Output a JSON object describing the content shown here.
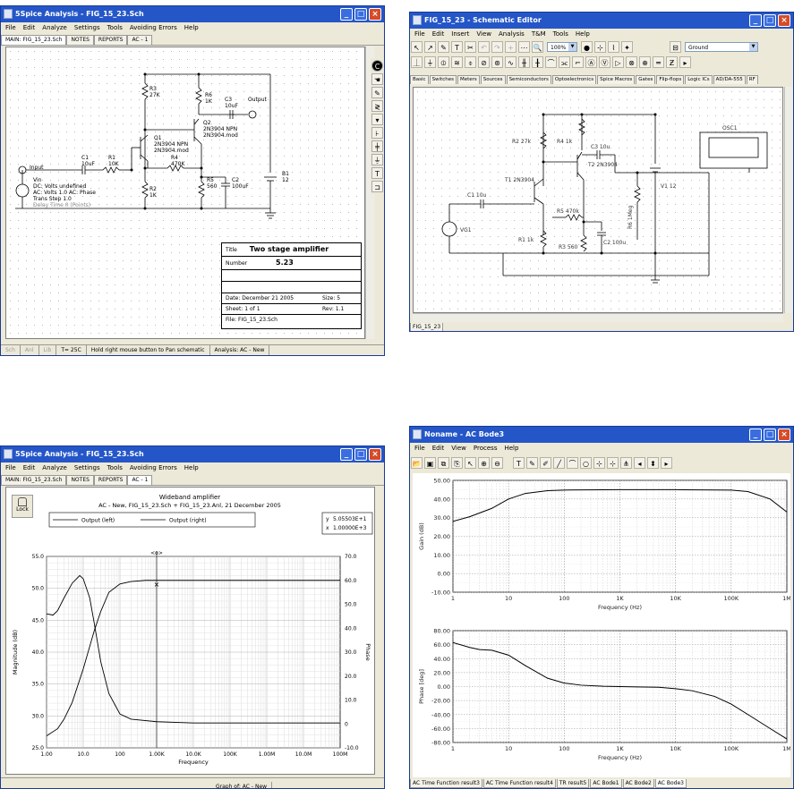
{
  "win1": {
    "title": "5Spice Analysis - FIG_15_23.Sch",
    "menu": [
      "File",
      "Edit",
      "Analyze",
      "Settings",
      "Tools",
      "Avoiding Errors",
      "Help"
    ],
    "tabs": [
      "MAIN: FIG_15_23.Sch",
      "NOTES",
      "REPORTS",
      "AC - 1"
    ],
    "components": {
      "r3": "R3",
      "r3v": "27K",
      "r6": "R6",
      "r6v": "1K",
      "c3": "C3",
      "c3v": "10uF",
      "output": "Output",
      "q2": "Q2",
      "q2m": "2N3904 NPN",
      "q2f": "2N3904.mod",
      "q1": "Q1",
      "q1m": "2N3904 NPN",
      "q1f": "2N3904.mod",
      "c1": "C1",
      "c1v": "10uF",
      "r1": "R1",
      "r1v": "10K",
      "r4": "R4",
      "r4v": "470K",
      "r5": "R5",
      "r5v": "560",
      "c2": "C2",
      "c2v": "100uF",
      "b1": "B1",
      "b1v": "12",
      "r2": "R2",
      "r2v": "1K",
      "input": "Input",
      "vin": "Vin",
      "vin_dc": "DC: Volts undefined",
      "vin_ac": "AC: Volts 1.0 AC: Phase",
      "vin_trans": "Trans Step 1.0",
      "vin_extra": "Delay Time 0 (Points)"
    },
    "titleblock": {
      "title_label": "Title",
      "title_value": "Two stage amplifier",
      "number_label": "Number",
      "number_value": "5.23",
      "date": "Date: December 21 2005",
      "size": "Size: 5",
      "sheet": "Sheet: 1 of 1",
      "rev": "Rev: 1.1",
      "file": "File: FIG_15_23.Sch"
    },
    "status": [
      "Sch",
      "Anl",
      "Lib",
      "T= 25C",
      "Hold right mouse button to Pan schematic",
      "Analysis: AC - New"
    ]
  },
  "win2": {
    "title": "FIG_15_23 - Schematic Editor",
    "menu": [
      "File",
      "Edit",
      "Insert",
      "View",
      "Analysis",
      "T&M",
      "Tools",
      "Help"
    ],
    "zoom": "100%",
    "ground": "Ground",
    "comp_tabs": [
      "Basic",
      "Switches",
      "Meters",
      "Sources",
      "Semiconductors",
      "Optoelectronics",
      "Spice Macros",
      "Gates",
      "Flip-flops",
      "Logic ICs",
      "AD/DA-555",
      "RF"
    ],
    "components": {
      "r2": "R2 27k",
      "r4": "R4 1k",
      "c3": "C3 10u",
      "t2": "T2 2N3904",
      "t1": "T1 2N3904",
      "c1": "C1 10u",
      "r5": "R5 470k",
      "v1": "V1 12",
      "r6": "R6 1Meg",
      "osc": "OSC1",
      "vg1": "VG1",
      "r1": "R1 1k",
      "r3": "R3 560",
      "c2": "C2 100u"
    },
    "sheet_tab": "FIG_15_23"
  },
  "win3": {
    "title": "5Spice Analysis - FIG_15_23.Sch",
    "menu": [
      "File",
      "Edit",
      "Analyze",
      "Settings",
      "Tools",
      "Avoiding Errors",
      "Help"
    ],
    "tabs": [
      "MAIN: FIG_15_23.Sch",
      "NOTES",
      "REPORTS",
      "AC - 1"
    ],
    "lock": "Lock",
    "graph_status": "Graph of: AC - New",
    "readout": {
      "y": "5.05503E+1",
      "x": "1.00000E+3"
    }
  },
  "win4": {
    "title": "Noname - AC Bode3",
    "menu": [
      "File",
      "Edit",
      "View",
      "Process",
      "Help"
    ],
    "tabs": [
      "AC Time Function result3",
      "AC Time Function result4",
      "TR result5",
      "AC Bode1",
      "AC Bode2",
      "AC Bode3"
    ]
  },
  "chart_data": [
    {
      "type": "line",
      "title": "Wideband amplifier",
      "subtitle": "AC - New,  FIG_15_23.Sch + FIG_15_23.Anl,  21 December 2005",
      "xlabel": "Frequency",
      "ylabel": "Magnitude (dB)",
      "y2label": "Phase",
      "xscale": "log",
      "xlim": [
        1,
        100000000
      ],
      "ylim": [
        25,
        55
      ],
      "y2lim": [
        -10,
        70
      ],
      "xticks": [
        "1.00",
        "10.0",
        "100",
        "1.00K",
        "10.0K",
        "100K",
        "1.00M",
        "10.0M",
        "100M"
      ],
      "yticks": [
        "25.0",
        "30.0",
        "35.0",
        "40.0",
        "45.0",
        "50.0",
        "55.0"
      ],
      "y2ticks": [
        "-10.0",
        "0",
        "10.0",
        "20.0",
        "30.0",
        "40.0",
        "50.0",
        "60.0",
        "70.0"
      ],
      "legend": [
        "Output (left)",
        "Output (right)"
      ],
      "legend_position": "top",
      "series": [
        {
          "name": "Output (left)",
          "axis": "left",
          "x": [
            1,
            1.5,
            2,
            3,
            5,
            8,
            10,
            15,
            20,
            30,
            50,
            100,
            200,
            1000,
            10000,
            100000,
            1000000,
            10000000,
            100000000
          ],
          "values": [
            46,
            45.8,
            46.5,
            48.5,
            50.8,
            52.0,
            51.5,
            48.5,
            44.5,
            38.5,
            33.5,
            30.3,
            29.5,
            29.1,
            28.9,
            28.9,
            28.9,
            28.9,
            28.9
          ]
        },
        {
          "name": "Output (right)",
          "axis": "right",
          "x": [
            1,
            2,
            3,
            5,
            10,
            20,
            30,
            50,
            100,
            200,
            500,
            1000,
            10000,
            100000,
            1000000,
            10000000,
            100000000
          ],
          "values": [
            -5,
            -2,
            2,
            9,
            23,
            39,
            47,
            55,
            58.5,
            59.5,
            60,
            60,
            60,
            60,
            60,
            60,
            60
          ]
        }
      ],
      "cursor": {
        "x": 1000,
        "y": 50.55
      }
    },
    {
      "type": "line",
      "xlabel": "Frequency (Hz)",
      "ylabel": "Gain (dB)",
      "xscale": "log",
      "xlim": [
        1,
        1000000
      ],
      "ylim": [
        -10,
        50
      ],
      "xticks": [
        "1",
        "10",
        "100",
        "1K",
        "10K",
        "100K",
        "1M"
      ],
      "yticks": [
        "-10.00",
        "0.00",
        "10.00",
        "20.00",
        "30.00",
        "40.00",
        "50.00"
      ],
      "series": [
        {
          "x": [
            1,
            2,
            5,
            10,
            20,
            50,
            100,
            1000,
            10000,
            100000,
            200000,
            500000,
            1000000
          ],
          "values": [
            28,
            30.5,
            35,
            40,
            43,
            44.5,
            44.8,
            45,
            45,
            44.8,
            44,
            40,
            33
          ]
        }
      ]
    },
    {
      "type": "line",
      "xlabel": "Frequency (Hz)",
      "ylabel": "Phase [deg]",
      "xscale": "log",
      "xlim": [
        1,
        1000000
      ],
      "ylim": [
        -80,
        80
      ],
      "xticks": [
        "1",
        "10",
        "100",
        "1K",
        "10K",
        "100K",
        "1M"
      ],
      "yticks": [
        "-80.00",
        "-60.00",
        "-40.00",
        "-20.00",
        "0.00",
        "20.00",
        "40.00",
        "60.00",
        "80.00"
      ],
      "series": [
        {
          "x": [
            1,
            2,
            3,
            5,
            10,
            20,
            50,
            100,
            200,
            500,
            1000,
            2000,
            5000,
            10000,
            20000,
            50000,
            100000,
            200000,
            500000,
            1000000
          ],
          "values": [
            63,
            56,
            53,
            52,
            45,
            30,
            12,
            5,
            2,
            0.5,
            0,
            -0.5,
            -1,
            -3,
            -6,
            -14,
            -25,
            -40,
            -60,
            -75
          ]
        }
      ]
    }
  ]
}
